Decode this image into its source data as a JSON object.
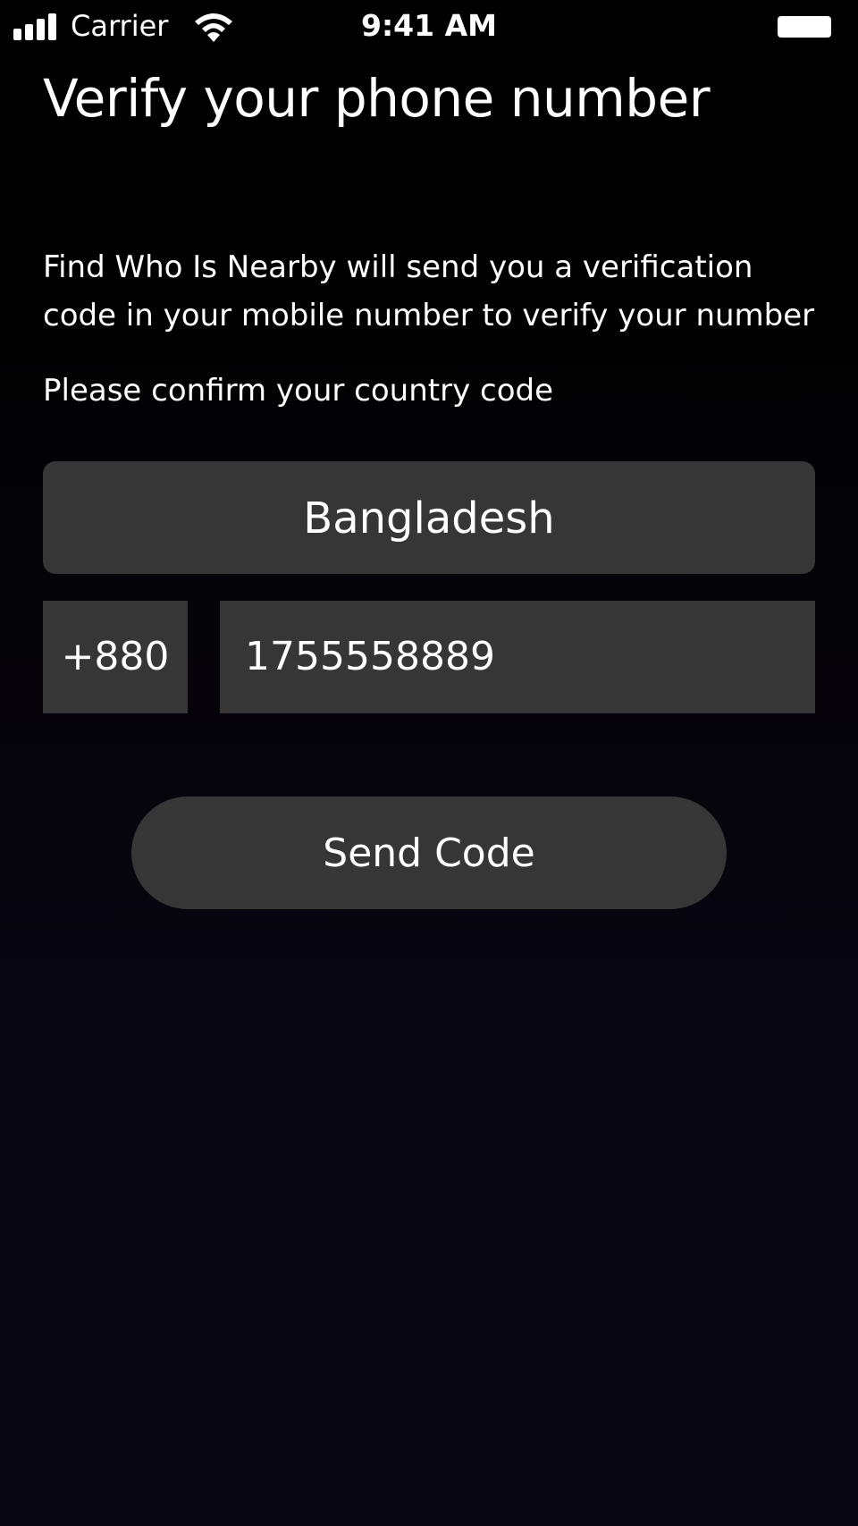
{
  "status_bar": {
    "carrier": "Carrier",
    "time": "9:41 AM",
    "signal_bars": 4,
    "icons": [
      "signal-icon",
      "wifi-icon",
      "battery-icon"
    ]
  },
  "header": {
    "title": "Verify your phone number"
  },
  "main": {
    "description": "Find Who Is Nearby will send you a verification code in your mobile number to verify your number",
    "country_prompt": "Please confirm your country code",
    "country": "Bangladesh",
    "dial_code": "+880",
    "phone_number": "1755558889",
    "send_button_label": "Send Code"
  },
  "colors": {
    "background": "#000000",
    "background_bottom": "#080612",
    "field_background": "#363636",
    "text": "#ffffff"
  }
}
